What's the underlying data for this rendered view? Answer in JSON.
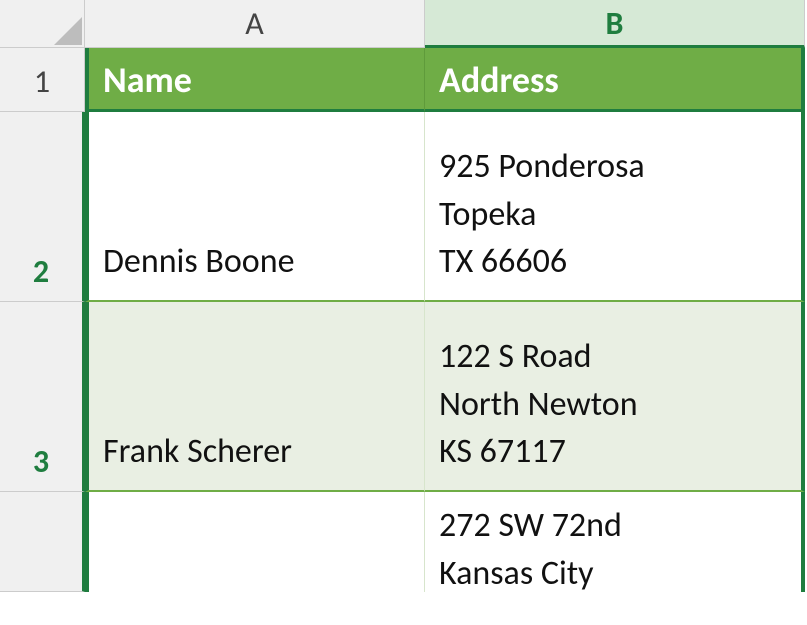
{
  "columns": {
    "A": "A",
    "B": "B"
  },
  "rownums": [
    "1",
    "2",
    "3"
  ],
  "headers": {
    "name": "Name",
    "address": "Address"
  },
  "rows": [
    {
      "name": "Dennis Boone",
      "address": "925 Ponderosa\nTopeka\nTX 66606"
    },
    {
      "name": "Frank Scherer",
      "address": "122 S Road\nNorth Newton\nKS 67117"
    },
    {
      "name": "",
      "address": "272 SW 72nd\nKansas City"
    }
  ]
}
